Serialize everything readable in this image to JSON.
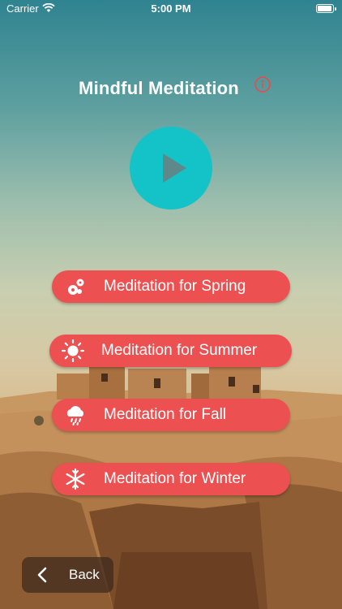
{
  "status_bar": {
    "carrier": "Carrier",
    "time": "5:00 PM"
  },
  "title": "Mindful Meditation",
  "buttons": [
    {
      "label": "Meditation for Spring",
      "icon": "flowers-icon"
    },
    {
      "label": "Meditation for Summer",
      "icon": "sun-icon"
    },
    {
      "label": "Meditation for Fall",
      "icon": "rain-cloud-icon"
    },
    {
      "label": "Meditation for Winter",
      "icon": "snowflake-icon"
    }
  ],
  "back": {
    "label": "Back"
  },
  "colors": {
    "accent_button": "#ec5050",
    "play_button": "#14c3c8",
    "info_icon": "#e94b4b"
  }
}
